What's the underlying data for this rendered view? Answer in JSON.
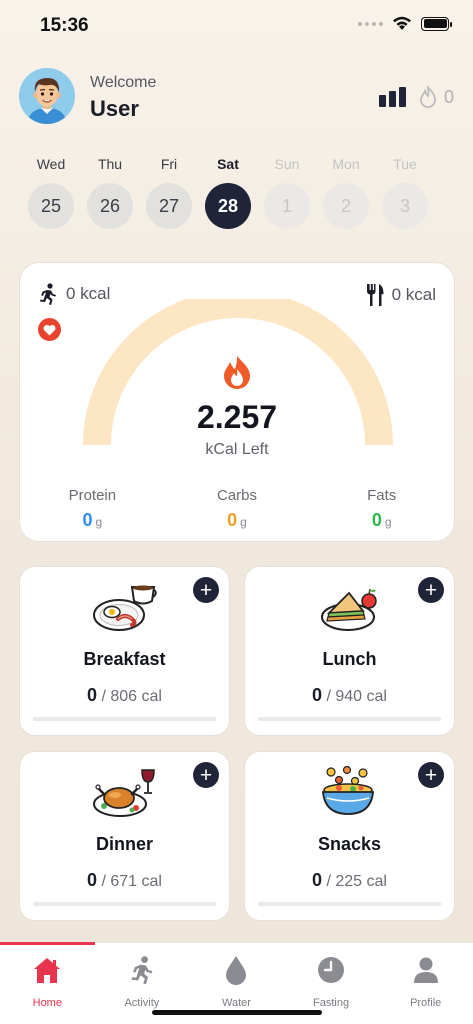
{
  "status": {
    "time": "15:36"
  },
  "header": {
    "welcome": "Welcome",
    "username": "User",
    "streak_count": "0"
  },
  "days": [
    {
      "name": "Wed",
      "num": "25",
      "state": "past"
    },
    {
      "name": "Thu",
      "num": "26",
      "state": "past"
    },
    {
      "name": "Fri",
      "num": "27",
      "state": "past"
    },
    {
      "name": "Sat",
      "num": "28",
      "state": "selected"
    },
    {
      "name": "Sun",
      "num": "1",
      "state": "future"
    },
    {
      "name": "Mon",
      "num": "2",
      "state": "future"
    },
    {
      "name": "Tue",
      "num": "3",
      "state": "future"
    }
  ],
  "summary": {
    "burned": "0 kcal",
    "eaten": "0 kcal",
    "kcal_left": "2.257",
    "kcal_label": "kCal Left",
    "macros": [
      {
        "label": "Protein",
        "value": "0",
        "unit": "g",
        "color": "#2f8cf0"
      },
      {
        "label": "Carbs",
        "value": "0",
        "unit": "g",
        "color": "#f0a020"
      },
      {
        "label": "Fats",
        "value": "0",
        "unit": "g",
        "color": "#2eb84a"
      }
    ]
  },
  "meals": {
    "breakfast": {
      "name": "Breakfast",
      "eaten": "0",
      "target": " / 806 cal",
      "icon": "breakfast-plate-icon",
      "progress": 0
    },
    "lunch": {
      "name": "Lunch",
      "eaten": "0",
      "target": " / 940 cal",
      "icon": "sandwich-plate-icon",
      "progress": 0
    },
    "dinner": {
      "name": "Dinner",
      "eaten": "0",
      "target": " / 671 cal",
      "icon": "roast-chicken-icon",
      "progress": 0
    },
    "snacks": {
      "name": "Snacks",
      "eaten": "0",
      "target": " / 225 cal",
      "icon": "snack-bowl-icon",
      "progress": 0
    }
  },
  "tabs": [
    {
      "label": "Home",
      "icon": "home-icon",
      "active": true
    },
    {
      "label": "Activity",
      "icon": "running-icon",
      "active": false
    },
    {
      "label": "Water",
      "icon": "water-drop-icon",
      "active": false
    },
    {
      "label": "Fasting",
      "icon": "clock-icon",
      "active": false
    },
    {
      "label": "Profile",
      "icon": "person-icon",
      "active": false
    }
  ],
  "colors": {
    "accent": "#e8344c",
    "dark": "#1f2438",
    "gauge": "#fde6c4",
    "flame": "#f05a28"
  }
}
